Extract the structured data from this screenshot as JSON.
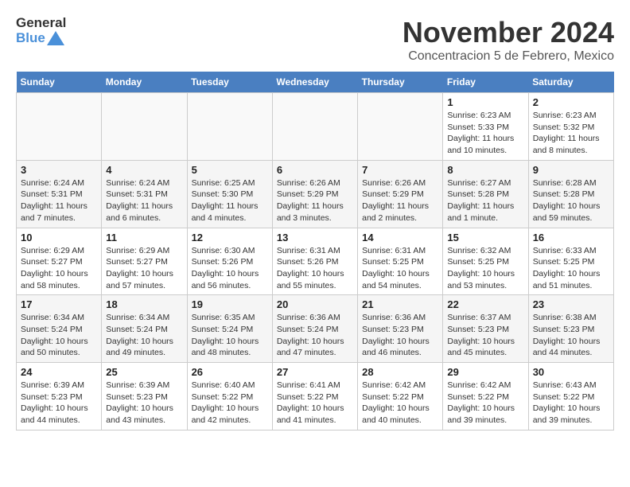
{
  "header": {
    "logo_general": "General",
    "logo_blue": "Blue",
    "month_title": "November 2024",
    "location": "Concentracion 5 de Febrero, Mexico"
  },
  "weekdays": [
    "Sunday",
    "Monday",
    "Tuesday",
    "Wednesday",
    "Thursday",
    "Friday",
    "Saturday"
  ],
  "weeks": [
    [
      {
        "day": "",
        "detail": ""
      },
      {
        "day": "",
        "detail": ""
      },
      {
        "day": "",
        "detail": ""
      },
      {
        "day": "",
        "detail": ""
      },
      {
        "day": "",
        "detail": ""
      },
      {
        "day": "1",
        "detail": "Sunrise: 6:23 AM\nSunset: 5:33 PM\nDaylight: 11 hours and 10 minutes."
      },
      {
        "day": "2",
        "detail": "Sunrise: 6:23 AM\nSunset: 5:32 PM\nDaylight: 11 hours and 8 minutes."
      }
    ],
    [
      {
        "day": "3",
        "detail": "Sunrise: 6:24 AM\nSunset: 5:31 PM\nDaylight: 11 hours and 7 minutes."
      },
      {
        "day": "4",
        "detail": "Sunrise: 6:24 AM\nSunset: 5:31 PM\nDaylight: 11 hours and 6 minutes."
      },
      {
        "day": "5",
        "detail": "Sunrise: 6:25 AM\nSunset: 5:30 PM\nDaylight: 11 hours and 4 minutes."
      },
      {
        "day": "6",
        "detail": "Sunrise: 6:26 AM\nSunset: 5:29 PM\nDaylight: 11 hours and 3 minutes."
      },
      {
        "day": "7",
        "detail": "Sunrise: 6:26 AM\nSunset: 5:29 PM\nDaylight: 11 hours and 2 minutes."
      },
      {
        "day": "8",
        "detail": "Sunrise: 6:27 AM\nSunset: 5:28 PM\nDaylight: 11 hours and 1 minute."
      },
      {
        "day": "9",
        "detail": "Sunrise: 6:28 AM\nSunset: 5:28 PM\nDaylight: 10 hours and 59 minutes."
      }
    ],
    [
      {
        "day": "10",
        "detail": "Sunrise: 6:29 AM\nSunset: 5:27 PM\nDaylight: 10 hours and 58 minutes."
      },
      {
        "day": "11",
        "detail": "Sunrise: 6:29 AM\nSunset: 5:27 PM\nDaylight: 10 hours and 57 minutes."
      },
      {
        "day": "12",
        "detail": "Sunrise: 6:30 AM\nSunset: 5:26 PM\nDaylight: 10 hours and 56 minutes."
      },
      {
        "day": "13",
        "detail": "Sunrise: 6:31 AM\nSunset: 5:26 PM\nDaylight: 10 hours and 55 minutes."
      },
      {
        "day": "14",
        "detail": "Sunrise: 6:31 AM\nSunset: 5:25 PM\nDaylight: 10 hours and 54 minutes."
      },
      {
        "day": "15",
        "detail": "Sunrise: 6:32 AM\nSunset: 5:25 PM\nDaylight: 10 hours and 53 minutes."
      },
      {
        "day": "16",
        "detail": "Sunrise: 6:33 AM\nSunset: 5:25 PM\nDaylight: 10 hours and 51 minutes."
      }
    ],
    [
      {
        "day": "17",
        "detail": "Sunrise: 6:34 AM\nSunset: 5:24 PM\nDaylight: 10 hours and 50 minutes."
      },
      {
        "day": "18",
        "detail": "Sunrise: 6:34 AM\nSunset: 5:24 PM\nDaylight: 10 hours and 49 minutes."
      },
      {
        "day": "19",
        "detail": "Sunrise: 6:35 AM\nSunset: 5:24 PM\nDaylight: 10 hours and 48 minutes."
      },
      {
        "day": "20",
        "detail": "Sunrise: 6:36 AM\nSunset: 5:24 PM\nDaylight: 10 hours and 47 minutes."
      },
      {
        "day": "21",
        "detail": "Sunrise: 6:36 AM\nSunset: 5:23 PM\nDaylight: 10 hours and 46 minutes."
      },
      {
        "day": "22",
        "detail": "Sunrise: 6:37 AM\nSunset: 5:23 PM\nDaylight: 10 hours and 45 minutes."
      },
      {
        "day": "23",
        "detail": "Sunrise: 6:38 AM\nSunset: 5:23 PM\nDaylight: 10 hours and 44 minutes."
      }
    ],
    [
      {
        "day": "24",
        "detail": "Sunrise: 6:39 AM\nSunset: 5:23 PM\nDaylight: 10 hours and 44 minutes."
      },
      {
        "day": "25",
        "detail": "Sunrise: 6:39 AM\nSunset: 5:23 PM\nDaylight: 10 hours and 43 minutes."
      },
      {
        "day": "26",
        "detail": "Sunrise: 6:40 AM\nSunset: 5:22 PM\nDaylight: 10 hours and 42 minutes."
      },
      {
        "day": "27",
        "detail": "Sunrise: 6:41 AM\nSunset: 5:22 PM\nDaylight: 10 hours and 41 minutes."
      },
      {
        "day": "28",
        "detail": "Sunrise: 6:42 AM\nSunset: 5:22 PM\nDaylight: 10 hours and 40 minutes."
      },
      {
        "day": "29",
        "detail": "Sunrise: 6:42 AM\nSunset: 5:22 PM\nDaylight: 10 hours and 39 minutes."
      },
      {
        "day": "30",
        "detail": "Sunrise: 6:43 AM\nSunset: 5:22 PM\nDaylight: 10 hours and 39 minutes."
      }
    ]
  ]
}
